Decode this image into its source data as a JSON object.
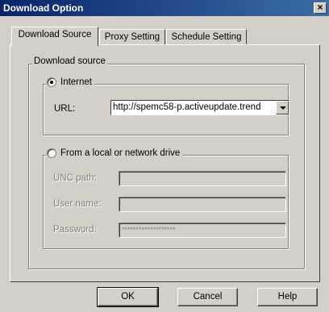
{
  "window": {
    "title": "Download Option",
    "close_label": "×"
  },
  "tabs": [
    {
      "label": "Download Source",
      "active": true
    },
    {
      "label": "Proxy Setting",
      "active": false
    },
    {
      "label": "Schedule Setting",
      "active": false
    }
  ],
  "download_source": {
    "group_label": "Download source",
    "internet": {
      "label": "Internet",
      "checked": true,
      "url_label": "URL:",
      "url_value": "http://spemc58-p.activeupdate.trend"
    },
    "local": {
      "label": "From a local or network drive",
      "checked": false,
      "unc_label": "UNC path:",
      "unc_value": "",
      "username_label": "User name:",
      "username_value": "",
      "password_label": "Password:",
      "password_value": "*******************"
    }
  },
  "buttons": {
    "ok": "OK",
    "cancel": "Cancel",
    "help": "Help"
  }
}
